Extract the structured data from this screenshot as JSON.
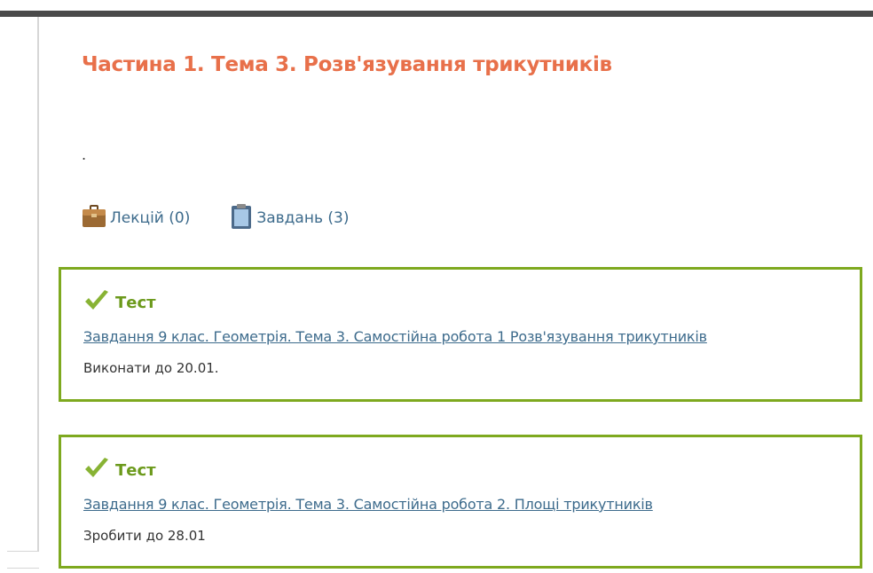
{
  "page": {
    "title": "Частина 1. Тема 3. Розв'язування трикутників",
    "description": "."
  },
  "stats": {
    "lectures_label": "Лекцій (0)",
    "tasks_label": "Завдань (3)"
  },
  "tasks": [
    {
      "type": "Тест",
      "title": "Завдання 9 клас. Геометрія. Тема 3. Самостійна робота 1 Розв'язування трикутників",
      "deadline": "Виконати до 20.01."
    },
    {
      "type": "Тест",
      "title": "Завдання 9 клас. Геометрія. Тема 3. Самостійна робота 2. Площі трикутників",
      "deadline": "Зробити до 28.01"
    }
  ],
  "colors": {
    "title": "#e8704a",
    "link": "#3d6b8c",
    "card_border": "#7ea91f",
    "task_type": "#6c9a1c",
    "top_bar": "#4a4a4a"
  },
  "icons": {
    "lectures": "briefcase-icon",
    "tasks": "clipboard-icon",
    "task_type": "checkmark-icon"
  }
}
